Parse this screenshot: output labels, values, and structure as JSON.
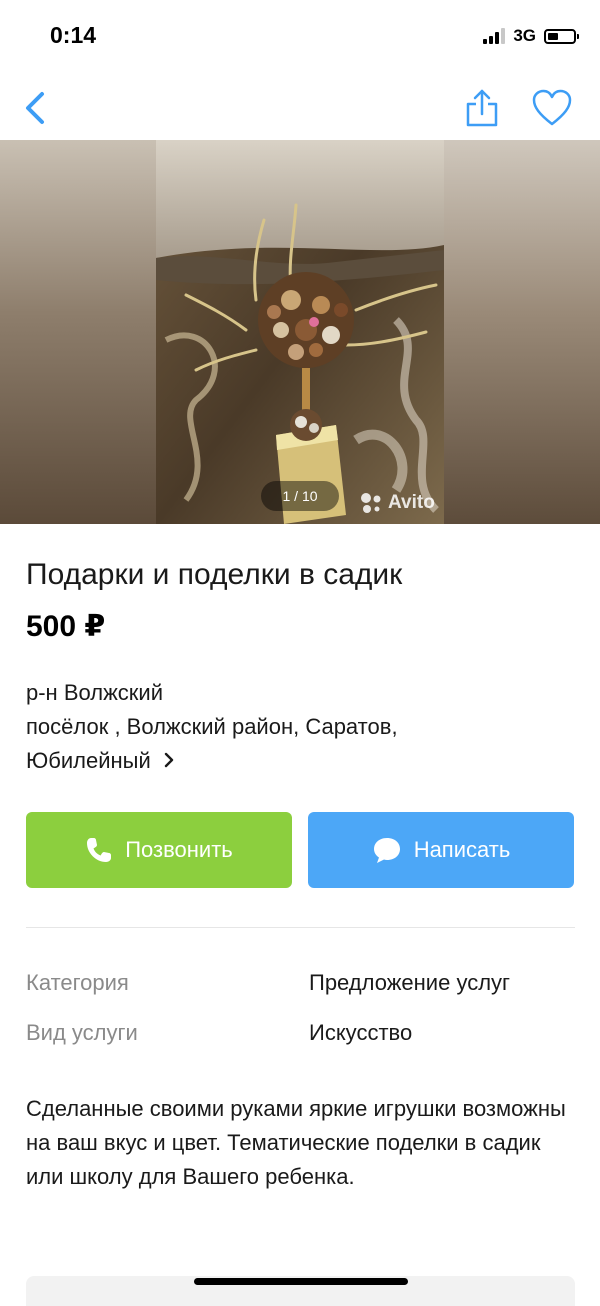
{
  "status_bar": {
    "time": "0:14",
    "network": "3G"
  },
  "nav": {
    "back_icon": "chevron-left-icon",
    "share_icon": "share-icon",
    "favorite_icon": "heart-icon",
    "accent_color": "#3d9df5"
  },
  "gallery": {
    "counter": "1 / 10",
    "watermark": "Avito"
  },
  "listing": {
    "title": "Подарки и поделки в садик",
    "price": "500 ₽",
    "address": {
      "line1": "р-н Волжский",
      "line2": "посёлок , Волжский район, Саратов,",
      "line3": "Юбилейный"
    }
  },
  "actions": {
    "call_label": "Позвонить",
    "call_color": "#8ccf3e",
    "message_label": "Написать",
    "message_color": "#4ca7f7"
  },
  "params": [
    {
      "label": "Категория",
      "value": "Предложение услуг"
    },
    {
      "label": "Вид услуги",
      "value": "Искусство"
    }
  ],
  "description": "Сделанные своими руками яркие игрушки возможны на ваш вкус и цвет. Тематические поделки в садик или школу для Вашего ребенка."
}
